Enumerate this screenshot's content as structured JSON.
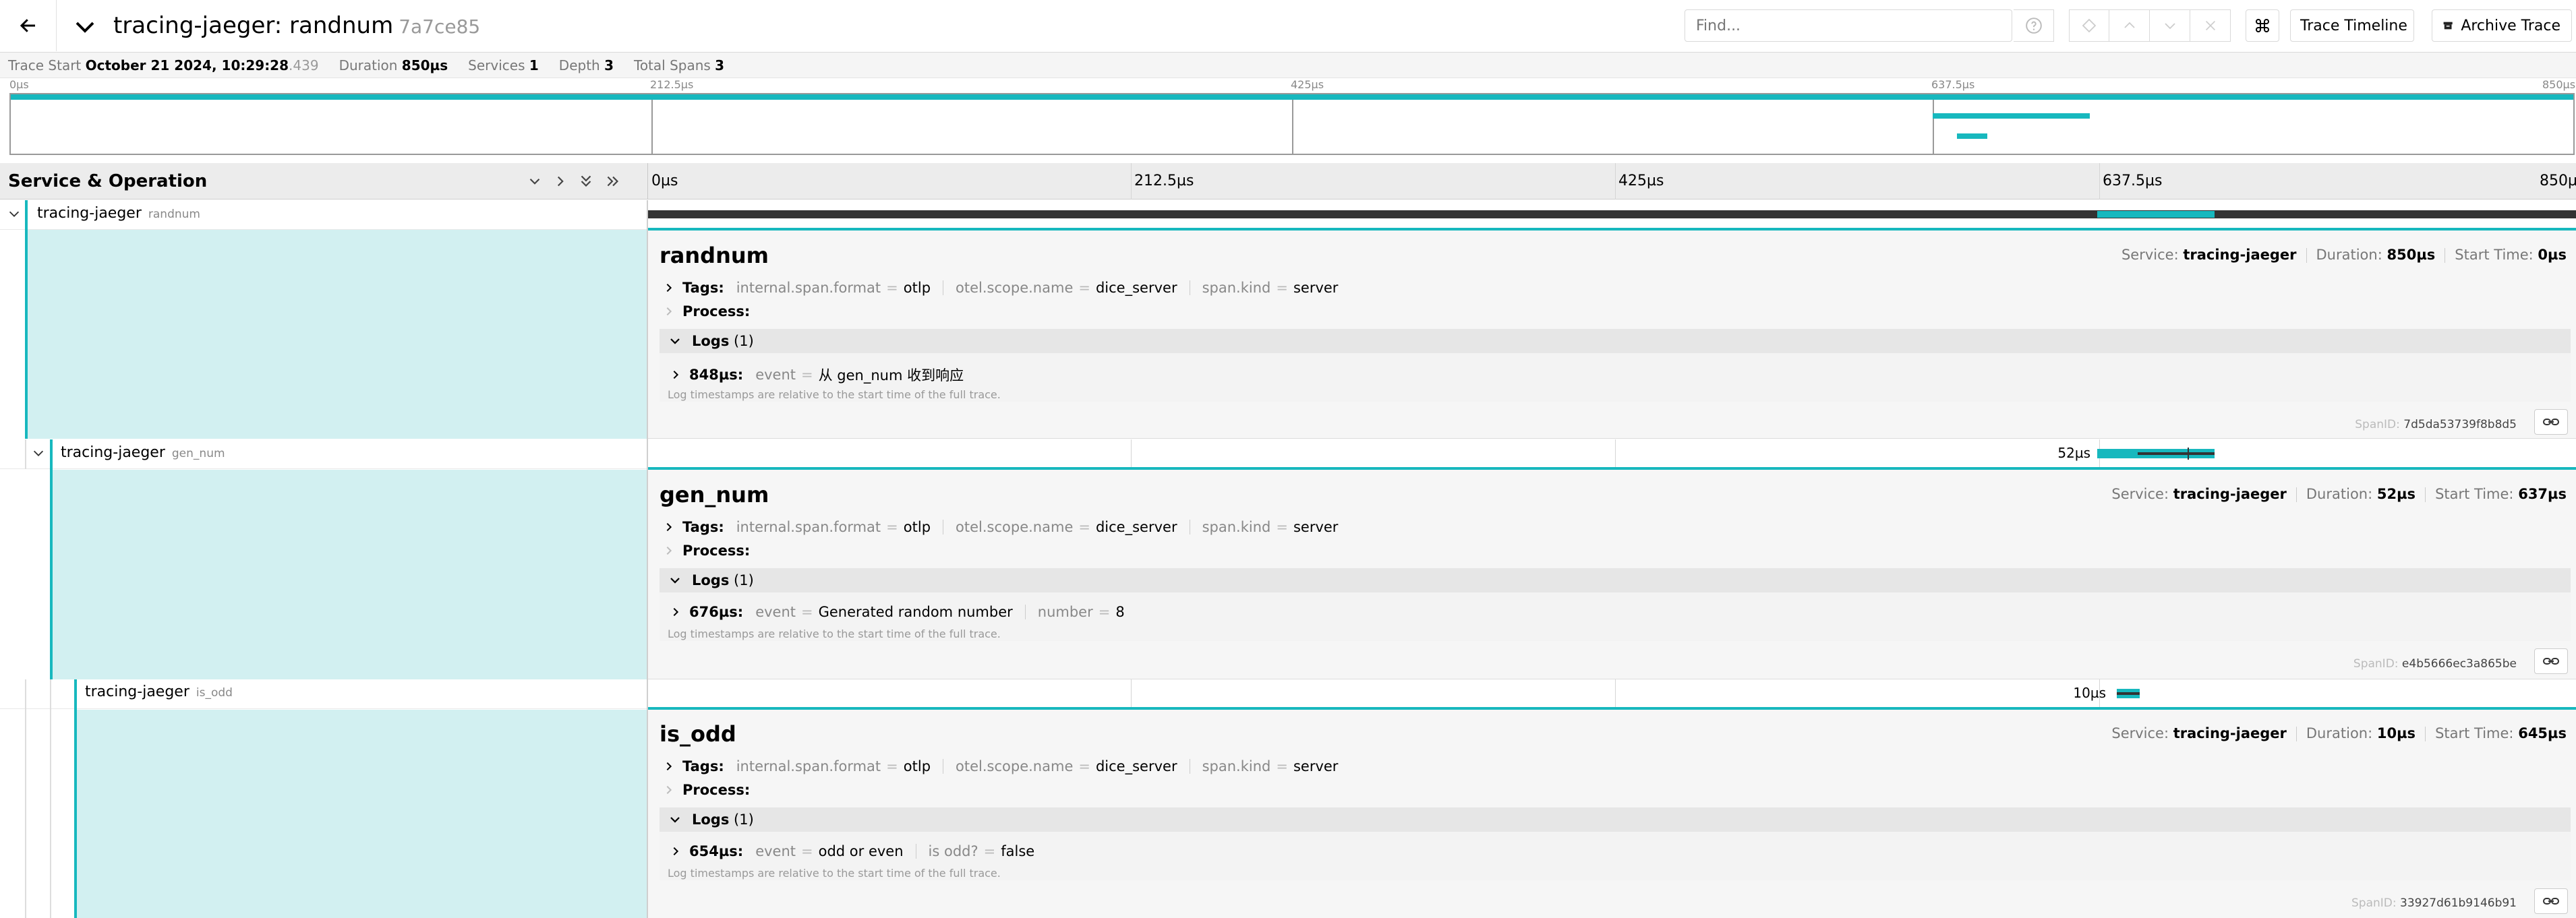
{
  "header": {
    "title": "tracing-jaeger: randnum",
    "trace_id": "7a7ce85",
    "find_placeholder": "Find...",
    "view_select": "Trace Timeline",
    "archive_label": "Archive Trace"
  },
  "summary": {
    "trace_start_label": "Trace Start",
    "trace_start_value": "October 21 2024, 10:29:28",
    "trace_start_ms": ".439",
    "duration_label": "Duration",
    "duration_value": "850µs",
    "services_label": "Services",
    "services_value": "1",
    "depth_label": "Depth",
    "depth_value": "3",
    "total_spans_label": "Total Spans",
    "total_spans_value": "3"
  },
  "minimap_ticks": [
    "0µs",
    "212.5µs",
    "425µs",
    "637.5µs",
    "850µs"
  ],
  "timeline": {
    "header_label": "Service & Operation",
    "ticks": [
      "0µs",
      "212.5µs",
      "425µs",
      "637.5µs",
      "850µs"
    ]
  },
  "spans": [
    {
      "service": "tracing-jaeger",
      "operation": "randnum",
      "duration_label": "",
      "detail": {
        "title": "randnum",
        "service_label": "Service:",
        "service": "tracing-jaeger",
        "duration_label": "Duration:",
        "duration": "850µs",
        "start_label": "Start Time:",
        "start": "0µs",
        "tags_label": "Tags:",
        "tags": [
          {
            "k": "internal.span.format",
            "v": "otlp"
          },
          {
            "k": "otel.scope.name",
            "v": "dice_server"
          },
          {
            "k": "span.kind",
            "v": "server"
          }
        ],
        "process_label": "Process:",
        "logs_label": "Logs",
        "logs_count": "(1)",
        "log_time": "848µs:",
        "log_fields": [
          {
            "k": "event",
            "v": "从 gen_num 收到响应"
          }
        ],
        "log_note": "Log timestamps are relative to the start time of the full trace.",
        "spanid_label": "SpanID:",
        "spanid": "7d5da53739f8b8d5"
      }
    },
    {
      "service": "tracing-jaeger",
      "operation": "gen_num",
      "duration_label": "52µs",
      "detail": {
        "title": "gen_num",
        "service_label": "Service:",
        "service": "tracing-jaeger",
        "duration_label": "Duration:",
        "duration": "52µs",
        "start_label": "Start Time:",
        "start": "637µs",
        "tags_label": "Tags:",
        "tags": [
          {
            "k": "internal.span.format",
            "v": "otlp"
          },
          {
            "k": "otel.scope.name",
            "v": "dice_server"
          },
          {
            "k": "span.kind",
            "v": "server"
          }
        ],
        "process_label": "Process:",
        "logs_label": "Logs",
        "logs_count": "(1)",
        "log_time": "676µs:",
        "log_fields": [
          {
            "k": "event",
            "v": "Generated random number"
          },
          {
            "k": "number",
            "v": "8"
          }
        ],
        "log_note": "Log timestamps are relative to the start time of the full trace.",
        "spanid_label": "SpanID:",
        "spanid": "e4b5666ec3a865be"
      }
    },
    {
      "service": "tracing-jaeger",
      "operation": "is_odd",
      "duration_label": "10µs",
      "detail": {
        "title": "is_odd",
        "service_label": "Service:",
        "service": "tracing-jaeger",
        "duration_label": "Duration:",
        "duration": "10µs",
        "start_label": "Start Time:",
        "start": "645µs",
        "tags_label": "Tags:",
        "tags": [
          {
            "k": "internal.span.format",
            "v": "otlp"
          },
          {
            "k": "otel.scope.name",
            "v": "dice_server"
          },
          {
            "k": "span.kind",
            "v": "server"
          }
        ],
        "process_label": "Process:",
        "logs_label": "Logs",
        "logs_count": "(1)",
        "log_time": "654µs:",
        "log_fields": [
          {
            "k": "event",
            "v": "odd or even"
          },
          {
            "k": "is odd?",
            "v": "false"
          }
        ],
        "log_note": "Log timestamps are relative to the start time of the full trace.",
        "spanid_label": "SpanID:",
        "spanid": "33927d61b9146b91"
      }
    }
  ],
  "colors": {
    "accent": "#17b8be",
    "detail_fill": "#d2f0f1",
    "bar_dark": "#333333"
  }
}
